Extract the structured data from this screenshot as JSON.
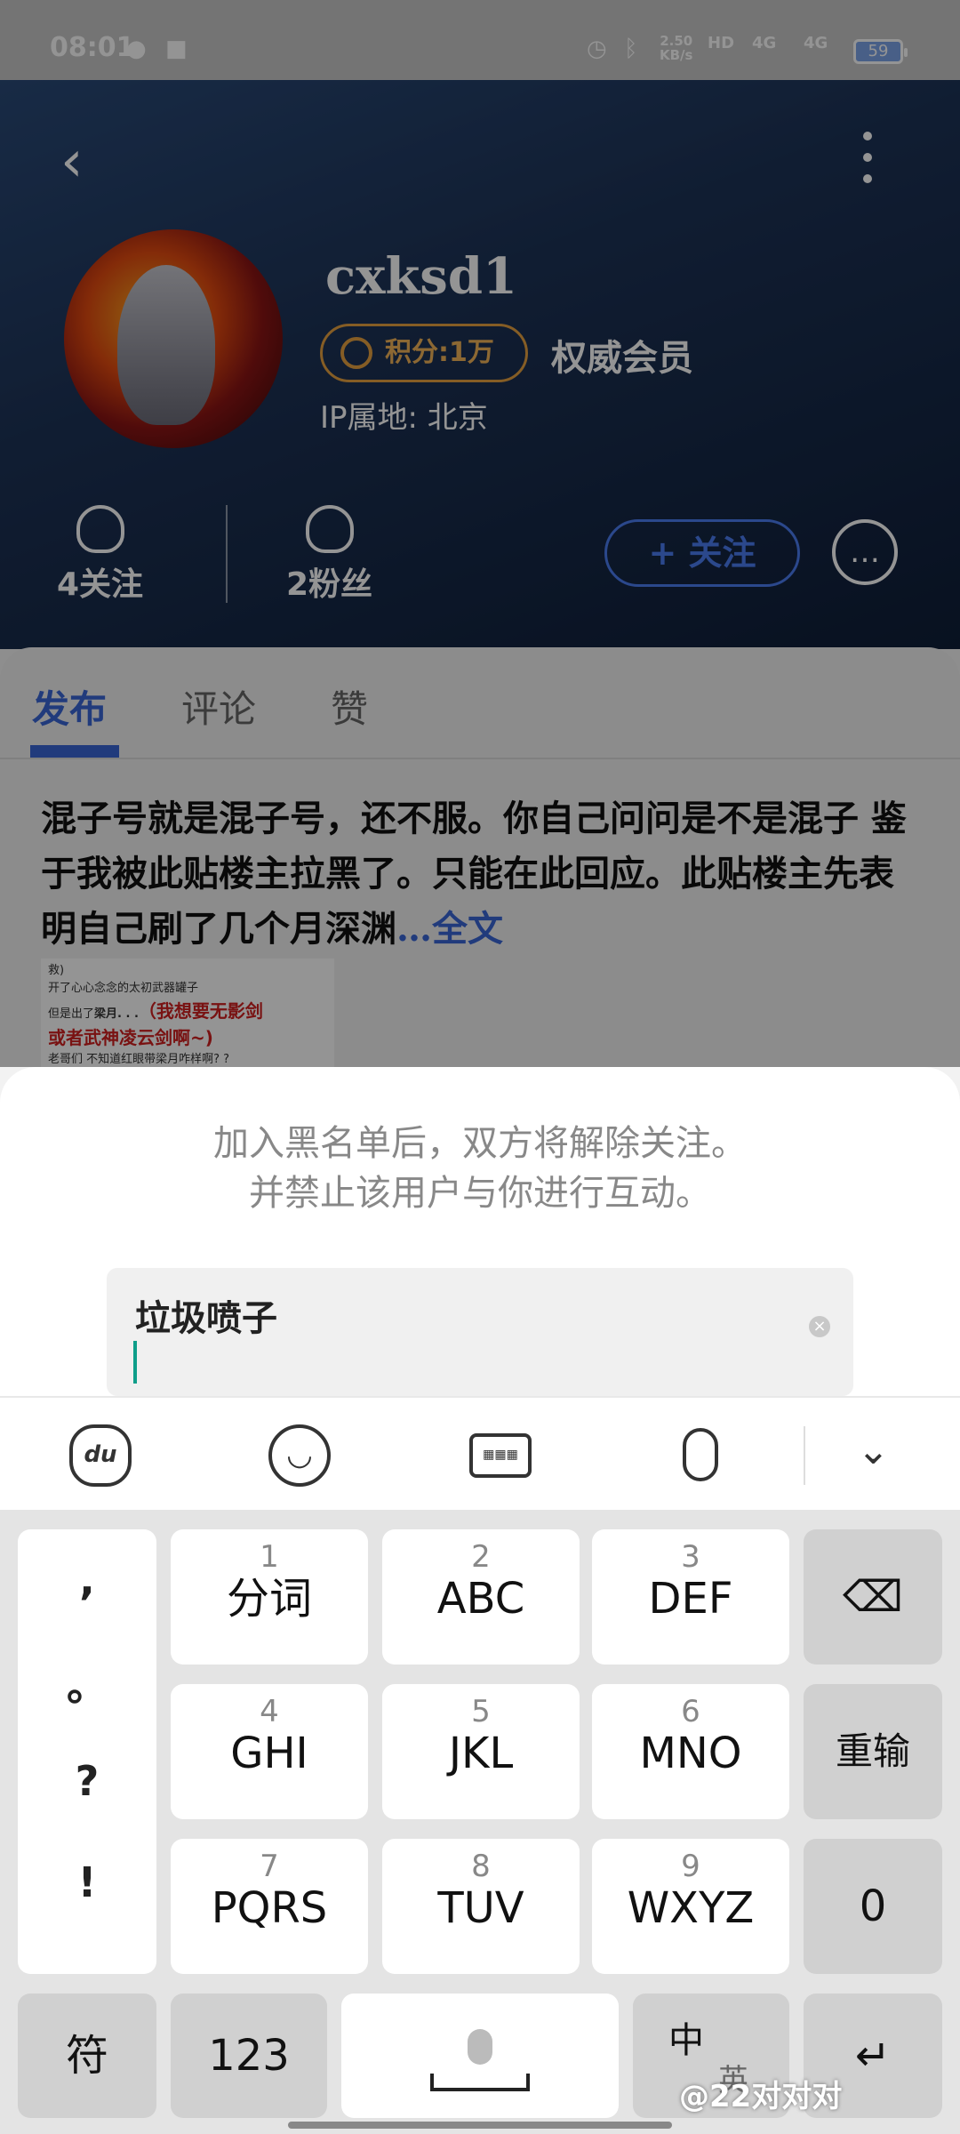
{
  "status_bar": {
    "time": "08:01",
    "speed_top": "2.50",
    "speed_bottom": "KB/s",
    "hd": "HD",
    "net1": "4G",
    "net2": "4G",
    "battery": "59"
  },
  "profile": {
    "username": "cxksd1",
    "points": "积分:1万",
    "member_level": "权威会员",
    "ip_location": "IP属地: 北京",
    "following": "4关注",
    "fans": "2粉丝",
    "follow_button": "+ 关注"
  },
  "tabs": [
    {
      "label": "发布"
    },
    {
      "label": "评论"
    },
    {
      "label": "赞"
    }
  ],
  "post": {
    "text": "混子号就是混子号，还不服。你自己问问是不是混子  鉴于我被此贴楼主拉黑了。只能在此回应。此贴楼主先表明自己刷了几个月深渊",
    "more_link": "…全文",
    "thumb": {
      "line1": "救)",
      "line2": "开了心心念念的太初武器罐子",
      "line3_prefix": "但是出了",
      "line3_name": "梁月. . .",
      "line3_hl": "（我想要无影剑",
      "line4_hl": "或者武神凌云剑啊~)",
      "line5": "老哥们 不知道红眼带梁月咋样啊? ?"
    }
  },
  "dialog": {
    "notice_line1": "加入黑名单后，双方将解除关注。",
    "notice_line2": "并禁止该用户与你进行互动。",
    "input_value": "垃圾喷子"
  },
  "keyboard": {
    "toolbar_du": "du",
    "punct": [
      ",",
      "。",
      "?",
      "!"
    ],
    "keys": [
      {
        "num": "1",
        "label": "分词"
      },
      {
        "num": "2",
        "label": "ABC"
      },
      {
        "num": "3",
        "label": "DEF"
      },
      {
        "num": "4",
        "label": "GHI"
      },
      {
        "num": "5",
        "label": "JKL"
      },
      {
        "num": "6",
        "label": "MNO"
      },
      {
        "num": "7",
        "label": "PQRS"
      },
      {
        "num": "8",
        "label": "TUV"
      },
      {
        "num": "9",
        "label": "WXYZ"
      }
    ],
    "delete": "⌫",
    "reenter": "重输",
    "zero": "0",
    "symbol": "符",
    "num123": "123",
    "lang_zh": "中",
    "lang_en": "英",
    "enter": "↵"
  },
  "watermark": "@22对对对"
}
